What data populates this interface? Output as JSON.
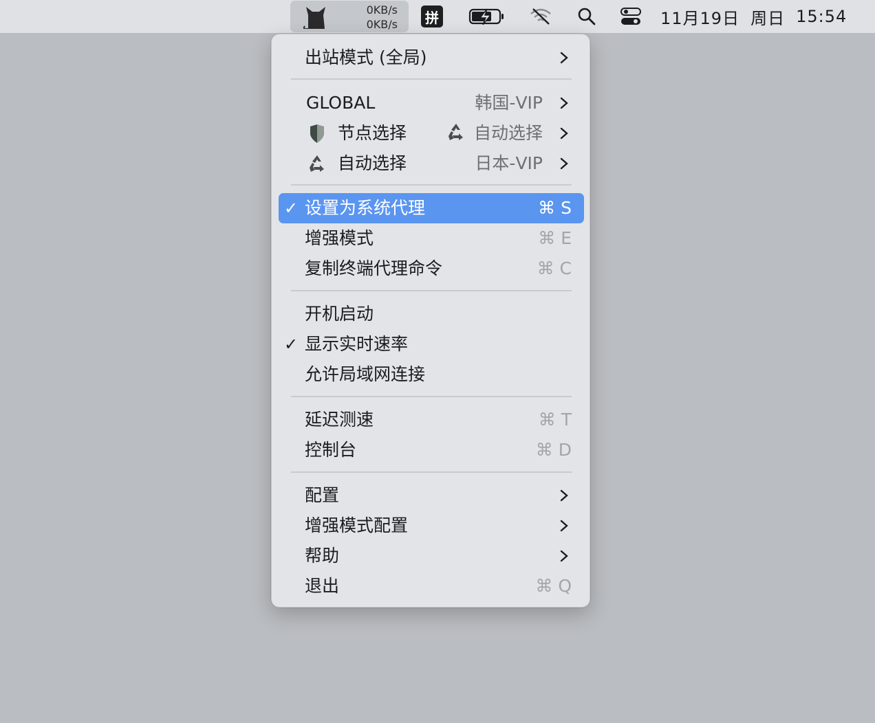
{
  "menubar": {
    "speed_up": "0KB/s",
    "speed_down": "0KB/s",
    "pinyin": "拼",
    "clock_date": "11月19日",
    "clock_weekday": "周日",
    "clock_time": "15:54",
    "icons": [
      "cat-app-icon",
      "pinyin-input-icon",
      "battery-charging-icon",
      "wifi-off-icon",
      "search-icon",
      "control-center-icon"
    ]
  },
  "menu": {
    "outbound_mode": "出站模式 (全局)",
    "groups": [
      {
        "name": "GLOBAL",
        "value": "韩国-VIP",
        "icon": ""
      },
      {
        "name": "节点选择",
        "value": "自动选择",
        "icon": "shield-icon",
        "value_icon": "recycle-icon"
      },
      {
        "name": "自动选择",
        "value": "日本-VIP",
        "icon": "recycle-icon"
      }
    ],
    "set_system_proxy": {
      "label": "设置为系统代理",
      "shortcut": "⌘ S",
      "checked": true
    },
    "enhanced_mode": {
      "label": "增强模式",
      "shortcut": "⌘ E"
    },
    "copy_terminal": {
      "label": "复制终端代理命令",
      "shortcut": "⌘ C"
    },
    "launch_at_login": {
      "label": "开机启动"
    },
    "show_speed": {
      "label": "显示实时速率",
      "checked": true
    },
    "allow_lan": {
      "label": "允许局域网连接"
    },
    "latency_test": {
      "label": "延迟测速",
      "shortcut": "⌘ T"
    },
    "dashboard": {
      "label": "控制台",
      "shortcut": "⌘ D"
    },
    "config": {
      "label": "配置"
    },
    "enhanced_config": {
      "label": "增强模式配置"
    },
    "help": {
      "label": "帮助"
    },
    "quit": {
      "label": "退出",
      "shortcut": "⌘ Q"
    },
    "check_mark": "✓",
    "colors": {
      "highlight": "#5a95f0",
      "menu_bg": "#e3e4e7",
      "desktop": "#babdc1"
    }
  }
}
